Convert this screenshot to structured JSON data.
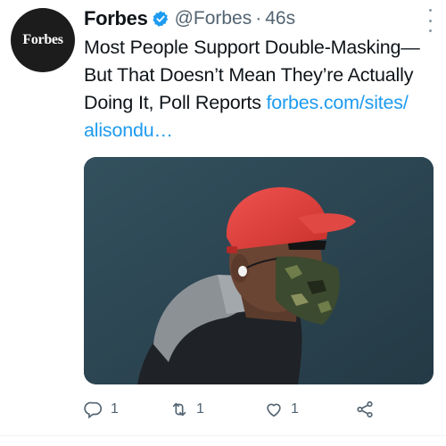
{
  "tweet": {
    "avatar_text": "Forbes",
    "display_name": "Forbes",
    "verified_icon": "verified-badge-icon",
    "handle": "@Forbes",
    "separator": "·",
    "time": "46s",
    "text_lines": [
      "Most People Support Double-Masking—",
      "But That Doesn’t Mean They’re Actually",
      "Doing It, Poll Reports "
    ],
    "link_part1": "forbes.com/sites/",
    "link_part2": "alisondu…",
    "actions": {
      "reply_count": "1",
      "retweet_count": "1",
      "like_count": "1"
    }
  },
  "colors": {
    "link": "#1d9bf0",
    "verified": "#1d9bf0",
    "muted": "#536471"
  }
}
